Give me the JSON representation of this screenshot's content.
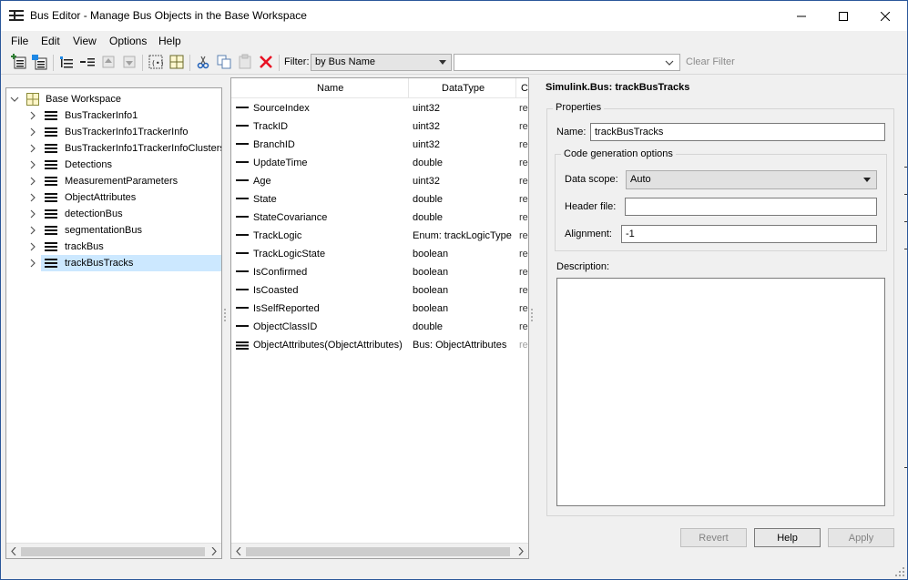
{
  "window": {
    "title": "Bus Editor - Manage Bus Objects in the Base Workspace"
  },
  "menu": [
    "File",
    "Edit",
    "View",
    "Options",
    "Help"
  ],
  "toolbar": {
    "filter_label": "Filter:",
    "filter_mode": "by Bus Name",
    "filter_value": "",
    "clear_filter": "Clear Filter"
  },
  "tree": {
    "root": "Base Workspace",
    "items": [
      "BusTrackerInfo1",
      "BusTrackerInfo1TrackerInfo",
      "BusTrackerInfo1TrackerInfoClusters",
      "Detections",
      "MeasurementParameters",
      "ObjectAttributes",
      "detectionBus",
      "segmentationBus",
      "trackBus",
      "trackBusTracks"
    ],
    "selected": "trackBusTracks"
  },
  "elements": {
    "columns": [
      "Name",
      "DataType",
      "Co"
    ],
    "rows": [
      {
        "name": "SourceIndex",
        "type": "uint32",
        "comp": "re"
      },
      {
        "name": "TrackID",
        "type": "uint32",
        "comp": "re"
      },
      {
        "name": "BranchID",
        "type": "uint32",
        "comp": "re"
      },
      {
        "name": "UpdateTime",
        "type": "double",
        "comp": "re"
      },
      {
        "name": "Age",
        "type": "uint32",
        "comp": "re"
      },
      {
        "name": "State",
        "type": "double",
        "comp": "re"
      },
      {
        "name": "StateCovariance",
        "type": "double",
        "comp": "re"
      },
      {
        "name": "TrackLogic",
        "type": "Enum: trackLogicType",
        "comp": "re"
      },
      {
        "name": "TrackLogicState",
        "type": "boolean",
        "comp": "re"
      },
      {
        "name": "IsConfirmed",
        "type": "boolean",
        "comp": "re"
      },
      {
        "name": "IsCoasted",
        "type": "boolean",
        "comp": "re"
      },
      {
        "name": "IsSelfReported",
        "type": "boolean",
        "comp": "re"
      },
      {
        "name": "ObjectClassID",
        "type": "double",
        "comp": "re"
      },
      {
        "name": "ObjectAttributes(ObjectAttributes)",
        "type": "Bus: ObjectAttributes",
        "comp": "re"
      }
    ]
  },
  "properties": {
    "title": "Simulink.Bus: trackBusTracks",
    "group_label": "Properties",
    "name_label": "Name:",
    "name_value": "trackBusTracks",
    "codegen_label": "Code generation options",
    "data_scope_label": "Data scope:",
    "data_scope_value": "Auto",
    "header_file_label": "Header file:",
    "header_file_value": "",
    "alignment_label": "Alignment:",
    "alignment_value": "-1",
    "description_label": "Description:",
    "description_value": ""
  },
  "buttons": {
    "revert": "Revert",
    "help": "Help",
    "apply": "Apply"
  },
  "colors": {
    "selection": "#cce8ff",
    "window_border": "#2b579a",
    "delete_red": "#e81123"
  }
}
